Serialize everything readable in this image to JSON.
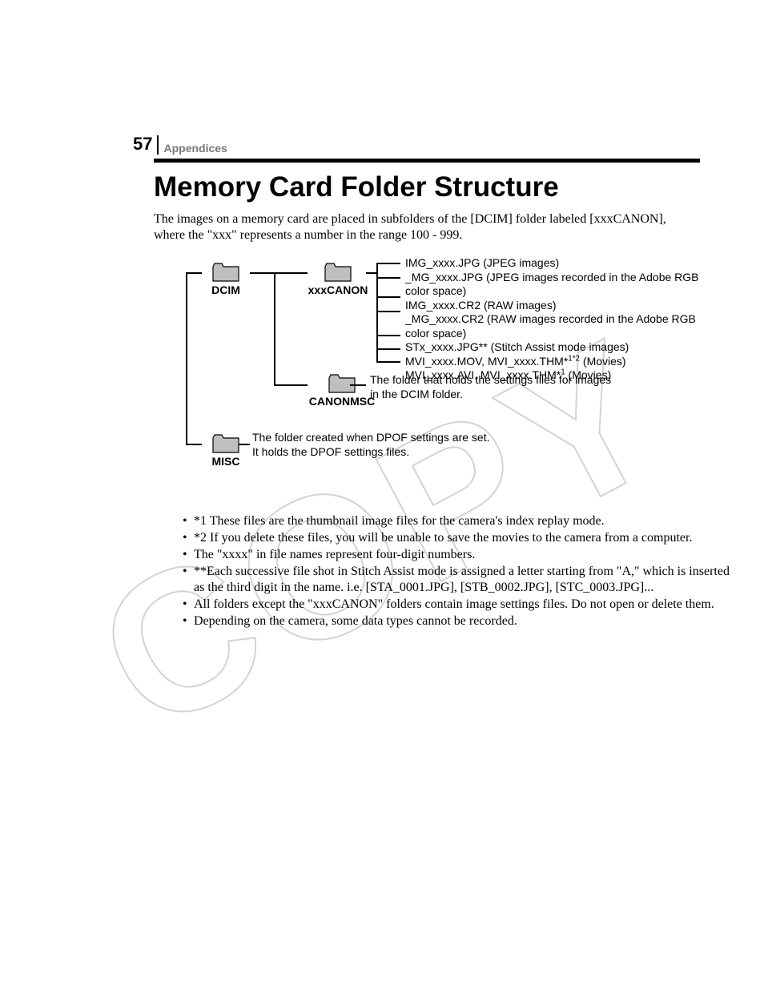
{
  "page_number": "57",
  "section_label": "Appendices",
  "title": "Memory Card Folder Structure",
  "intro": "The images on a memory card are placed in subfolders of the [DCIM] folder labeled [xxxCANON], where the \"xxx\" represents a number in the range 100 - 999.",
  "watermark": "COPY",
  "folders": {
    "dcim": "DCIM",
    "xxxcanon": "xxxCANON",
    "canonmsc": "CANONMSC",
    "misc": "MISC"
  },
  "file_list": {
    "l1": "IMG_xxxx.JPG (JPEG images)",
    "l2": "_MG_xxxx.JPG (JPEG images recorded in the Adobe RGB color space)",
    "l3": "IMG_xxxx.CR2 (RAW images)",
    "l4": "_MG_xxxx.CR2 (RAW images recorded in the Adobe RGB color space)",
    "l5": "STx_xxxx.JPG** (Stitch Assist mode images)",
    "l6a": "MVI_xxxx.MOV, MVI_xxxx.THM*",
    "l6b": " (Movies)",
    "l7a": "MVI_xxxx.AVI, MVI_xxxx.THM*",
    "l7b": " (Movies)",
    "sup12": "1*2",
    "sup1": "1"
  },
  "canonmsc_desc": "The folder that holds the settings files for images in the DCIM folder.",
  "misc_desc_l1": "The folder created when DPOF settings are set.",
  "misc_desc_l2": "It holds the DPOF settings files.",
  "notes": {
    "n1": "*1 These files are the thumbnail image files for the camera's index replay mode.",
    "n2": "*2 If you delete these files, you will be unable to save the movies to the camera from a computer.",
    "n3": "The \"xxxx\" in file names represent four-digit numbers.",
    "n4": "**Each successive file shot in Stitch Assist mode is assigned a letter starting from \"A,\" which is inserted as the third digit in the name. i.e. [STA_0001.JPG], [STB_0002.JPG], [STC_0003.JPG]...",
    "n5": "All folders except the \"xxxCANON\" folders contain image settings files. Do not open or delete them.",
    "n6": "Depending on the camera, some data types cannot be recorded."
  }
}
